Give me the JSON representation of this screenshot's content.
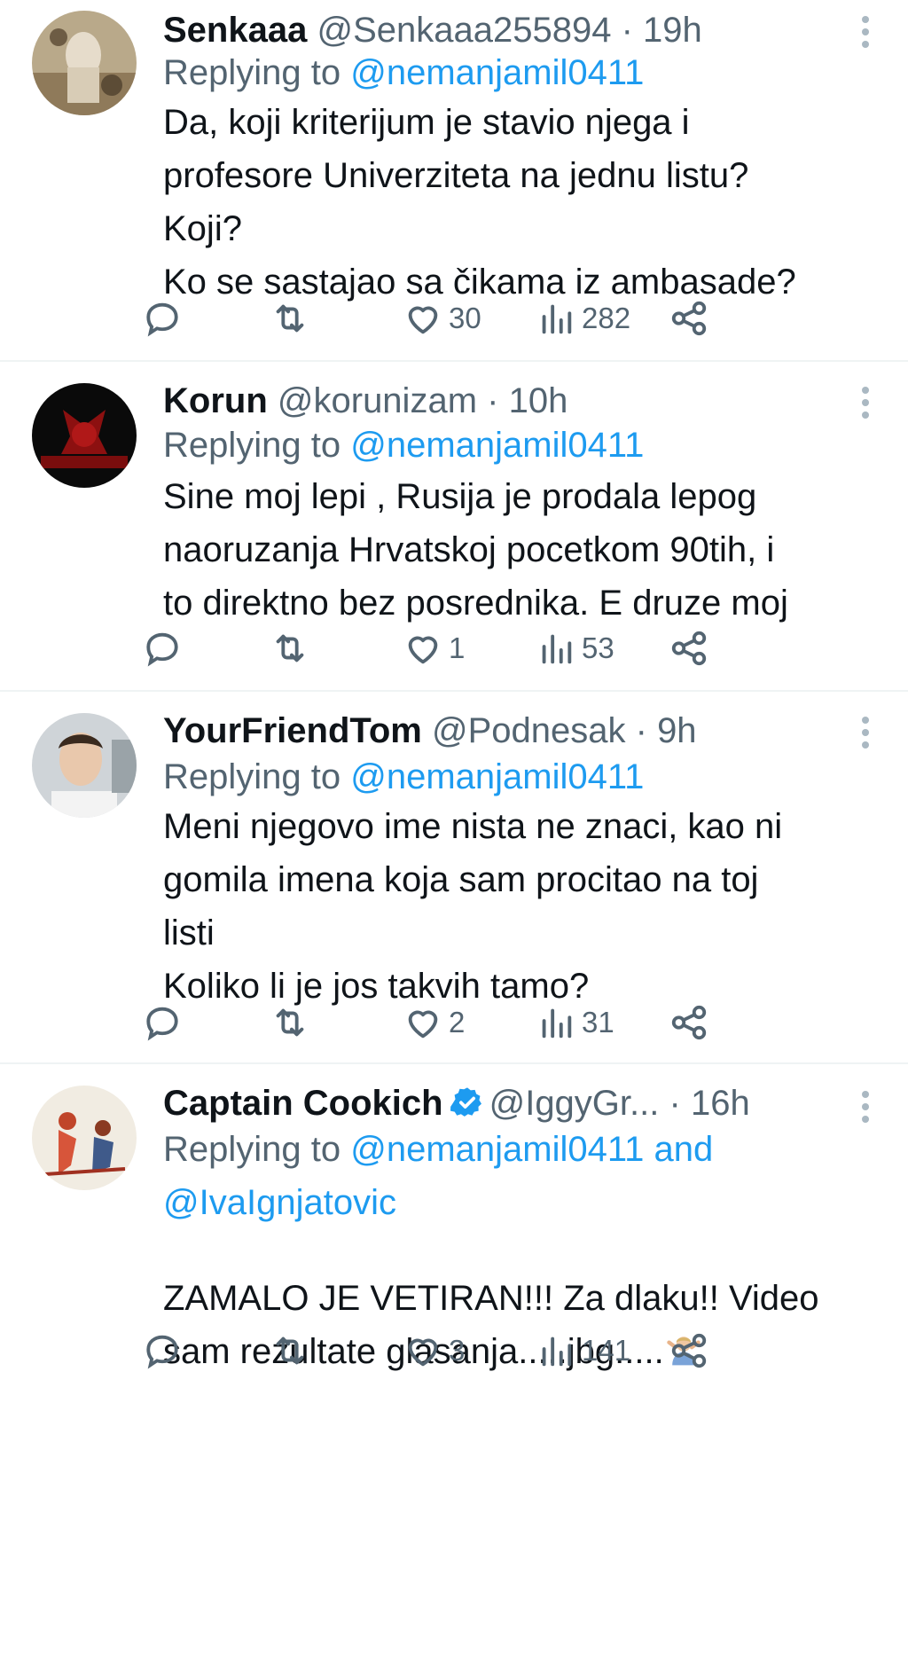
{
  "colors": {
    "link": "#1d9bf0",
    "muted": "#536471",
    "text": "#0f1419",
    "divider": "#eff3f4",
    "verified": "#1d9bf0"
  },
  "icons": [
    "reply-icon",
    "retweet-icon",
    "like-icon",
    "views-icon",
    "share-icon",
    "more-icon",
    "verified-badge-icon",
    "shrug-emoji-icon"
  ],
  "tweets": [
    {
      "name": "Senkaaa",
      "handle": "@Senkaaa255894",
      "separator": "·",
      "time": "19h",
      "replying_label": "Replying to",
      "replying_to": "@nemanjamil0411",
      "text": "Da, koji kriterijum je stavio njega i\nprofesore Univerziteta na jednu listu?\nKoji?\nKo se sastajao sa čikama iz ambasade?",
      "likes": "30",
      "views": "282"
    },
    {
      "name": "Korun",
      "handle": "@korunizam",
      "separator": "·",
      "time": "10h",
      "replying_label": "Replying to",
      "replying_to": "@nemanjamil0411",
      "text": "Sine moj lepi , Rusija je prodala lepog\nnaoruzanja Hrvatskoj pocetkom 90tih, i\nto direktno bez posrednika. E druze moj",
      "likes": "1",
      "views": "53"
    },
    {
      "name": "YourFriendTom",
      "handle": "@Podnesak",
      "separator": "·",
      "time": "9h",
      "replying_label": "Replying to",
      "replying_to": "@nemanjamil0411",
      "text": "Meni njegovo ime nista ne znaci, kao ni\ngomila imena koja sam procitao na toj\nlisti\nKoliko li je jos takvih tamo?",
      "likes": "2",
      "views": "31"
    },
    {
      "name": "Captain Cookich",
      "handle": "@IggyGr...",
      "separator": "·",
      "time": "16h",
      "replying_label": "Replying to",
      "replying_to": "@nemanjamil0411",
      "replying_and": "and",
      "replying_to_2": "@IvaIgnjatovic",
      "text": "ZAMALO JE VETIRAN!!! Za dlaku!! Video\nsam rezultate glasanja.....jbg.....",
      "likes": "3",
      "views": "141"
    }
  ]
}
